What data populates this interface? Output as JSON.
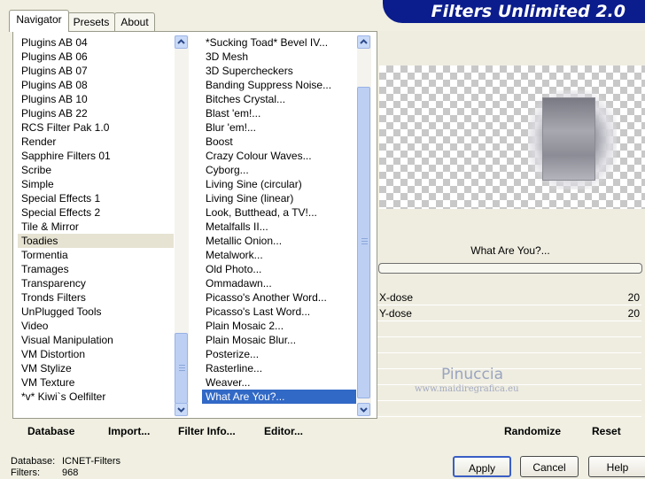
{
  "tabs": [
    "Navigator",
    "Presets",
    "About"
  ],
  "app_title": "Filters Unlimited 2.0",
  "categories": [
    "Plugins AB 04",
    "Plugins AB 06",
    "Plugins AB 07",
    "Plugins AB 08",
    "Plugins AB 10",
    "Plugins AB 22",
    "RCS Filter Pak 1.0",
    "Render",
    "Sapphire Filters 01",
    "Scribe",
    "Simple",
    "Special Effects 1",
    "Special Effects 2",
    "Tile & Mirror",
    "Toadies",
    "Tormentia",
    "Tramages",
    "Transparency",
    "Tronds Filters",
    "UnPlugged Tools",
    "Video",
    "Visual Manipulation",
    "VM Distortion",
    "VM Stylize",
    "VM Texture",
    "*v* Kiwi`s Oelfilter"
  ],
  "selected_category": "Toadies",
  "filters": [
    "*Sucking Toad*  Bevel IV...",
    "3D Mesh",
    "3D Supercheckers",
    "Banding Suppress Noise...",
    "Bitches Crystal...",
    "Blast 'em!...",
    "Blur 'em!...",
    "Boost",
    "Crazy Colour Waves...",
    "Cyborg...",
    "Living Sine (circular)",
    "Living Sine (linear)",
    "Look, Butthead, a TV!...",
    "Metalfalls II...",
    "Metallic Onion...",
    "Metalwork...",
    "Old Photo...",
    "Ommadawn...",
    "Picasso's Another Word...",
    "Picasso's Last Word...",
    "Plain Mosaic 2...",
    "Plain Mosaic Blur...",
    "Posterize...",
    "Rasterline...",
    "Weaver...",
    "What Are You?..."
  ],
  "selected_filter": "What Are You?...",
  "bottom_buttons": [
    "Database",
    "Import...",
    "Filter Info...",
    "Editor..."
  ],
  "preview": {
    "filter_name": "What Are You?...",
    "params": [
      {
        "label": "X-dose",
        "value": "20"
      },
      {
        "label": "Y-dose",
        "value": "20"
      }
    ]
  },
  "watermark": {
    "name": "Pinuccia",
    "url": "www.maidiregrafica.eu"
  },
  "right_buttons": {
    "randomize": "Randomize",
    "reset": "Reset"
  },
  "status": {
    "database_label": "Database:",
    "database_value": "ICNET-Filters",
    "filters_label": "Filters:",
    "filters_value": "968"
  },
  "dialog_buttons": {
    "apply": "Apply",
    "cancel": "Cancel",
    "help": "Help"
  },
  "colors": {
    "title_banner": "#0b1c8c",
    "selection_blue": "#3169c6",
    "selection_grey": "#e6e3d3"
  }
}
